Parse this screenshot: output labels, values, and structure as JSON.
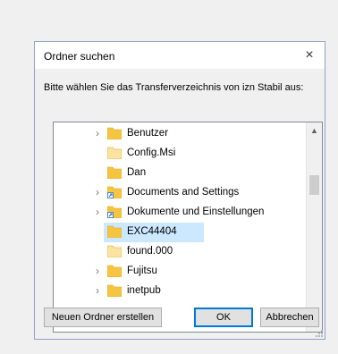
{
  "dialog": {
    "title": "Ordner suchen",
    "close_icon": "×",
    "instruction": "Bitte wählen Sie das Transferverzeichnis von izn Stabil aus:"
  },
  "tree": {
    "items": [
      {
        "label": "Benutzer",
        "icon": "folder-icon",
        "expandable": true,
        "selected": false
      },
      {
        "label": "Config.Msi",
        "icon": "folder-light-icon",
        "expandable": false,
        "selected": false
      },
      {
        "label": "Dan",
        "icon": "folder-icon",
        "expandable": false,
        "selected": false
      },
      {
        "label": "Documents and Settings",
        "icon": "folder-shortcut-icon",
        "expandable": true,
        "selected": false
      },
      {
        "label": "Dokumente und Einstellungen",
        "icon": "folder-shortcut-icon",
        "expandable": true,
        "selected": false
      },
      {
        "label": "EXC44404",
        "icon": "folder-icon",
        "expandable": false,
        "selected": true
      },
      {
        "label": "found.000",
        "icon": "folder-light-icon",
        "expandable": false,
        "selected": false
      },
      {
        "label": "Fujitsu",
        "icon": "folder-icon",
        "expandable": true,
        "selected": false
      },
      {
        "label": "inetpub",
        "icon": "folder-icon",
        "expandable": true,
        "selected": false
      }
    ],
    "expand_glyph": "›",
    "scroll_up_glyph": "▲",
    "scroll_down_glyph": "▼"
  },
  "buttons": {
    "new_folder": "Neuen Ordner erstellen",
    "ok": "OK",
    "cancel": "Abbrechen"
  },
  "colors": {
    "folder": "#f5c542",
    "folder_light": "#fbe3a1",
    "selection": "#cce8ff",
    "accent": "#0078d7"
  }
}
